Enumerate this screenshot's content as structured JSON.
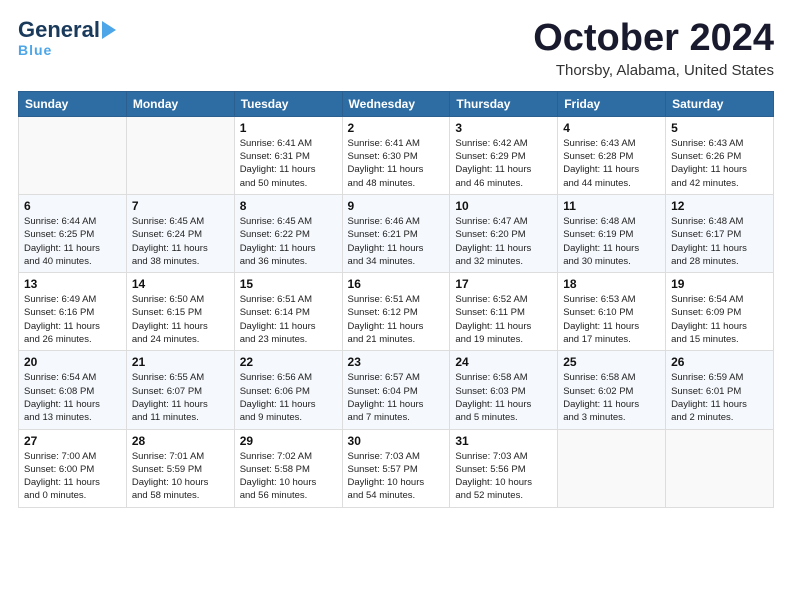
{
  "header": {
    "logo_line1a": "General",
    "logo_line1b": "Blue",
    "month": "October 2024",
    "location": "Thorsby, Alabama, United States"
  },
  "weekdays": [
    "Sunday",
    "Monday",
    "Tuesday",
    "Wednesday",
    "Thursday",
    "Friday",
    "Saturday"
  ],
  "weeks": [
    [
      {
        "day": "",
        "sunrise": "",
        "sunset": "",
        "daylight": ""
      },
      {
        "day": "",
        "sunrise": "",
        "sunset": "",
        "daylight": ""
      },
      {
        "day": "1",
        "sunrise": "Sunrise: 6:41 AM",
        "sunset": "Sunset: 6:31 PM",
        "daylight": "Daylight: 11 hours and 50 minutes."
      },
      {
        "day": "2",
        "sunrise": "Sunrise: 6:41 AM",
        "sunset": "Sunset: 6:30 PM",
        "daylight": "Daylight: 11 hours and 48 minutes."
      },
      {
        "day": "3",
        "sunrise": "Sunrise: 6:42 AM",
        "sunset": "Sunset: 6:29 PM",
        "daylight": "Daylight: 11 hours and 46 minutes."
      },
      {
        "day": "4",
        "sunrise": "Sunrise: 6:43 AM",
        "sunset": "Sunset: 6:28 PM",
        "daylight": "Daylight: 11 hours and 44 minutes."
      },
      {
        "day": "5",
        "sunrise": "Sunrise: 6:43 AM",
        "sunset": "Sunset: 6:26 PM",
        "daylight": "Daylight: 11 hours and 42 minutes."
      }
    ],
    [
      {
        "day": "6",
        "sunrise": "Sunrise: 6:44 AM",
        "sunset": "Sunset: 6:25 PM",
        "daylight": "Daylight: 11 hours and 40 minutes."
      },
      {
        "day": "7",
        "sunrise": "Sunrise: 6:45 AM",
        "sunset": "Sunset: 6:24 PM",
        "daylight": "Daylight: 11 hours and 38 minutes."
      },
      {
        "day": "8",
        "sunrise": "Sunrise: 6:45 AM",
        "sunset": "Sunset: 6:22 PM",
        "daylight": "Daylight: 11 hours and 36 minutes."
      },
      {
        "day": "9",
        "sunrise": "Sunrise: 6:46 AM",
        "sunset": "Sunset: 6:21 PM",
        "daylight": "Daylight: 11 hours and 34 minutes."
      },
      {
        "day": "10",
        "sunrise": "Sunrise: 6:47 AM",
        "sunset": "Sunset: 6:20 PM",
        "daylight": "Daylight: 11 hours and 32 minutes."
      },
      {
        "day": "11",
        "sunrise": "Sunrise: 6:48 AM",
        "sunset": "Sunset: 6:19 PM",
        "daylight": "Daylight: 11 hours and 30 minutes."
      },
      {
        "day": "12",
        "sunrise": "Sunrise: 6:48 AM",
        "sunset": "Sunset: 6:17 PM",
        "daylight": "Daylight: 11 hours and 28 minutes."
      }
    ],
    [
      {
        "day": "13",
        "sunrise": "Sunrise: 6:49 AM",
        "sunset": "Sunset: 6:16 PM",
        "daylight": "Daylight: 11 hours and 26 minutes."
      },
      {
        "day": "14",
        "sunrise": "Sunrise: 6:50 AM",
        "sunset": "Sunset: 6:15 PM",
        "daylight": "Daylight: 11 hours and 24 minutes."
      },
      {
        "day": "15",
        "sunrise": "Sunrise: 6:51 AM",
        "sunset": "Sunset: 6:14 PM",
        "daylight": "Daylight: 11 hours and 23 minutes."
      },
      {
        "day": "16",
        "sunrise": "Sunrise: 6:51 AM",
        "sunset": "Sunset: 6:12 PM",
        "daylight": "Daylight: 11 hours and 21 minutes."
      },
      {
        "day": "17",
        "sunrise": "Sunrise: 6:52 AM",
        "sunset": "Sunset: 6:11 PM",
        "daylight": "Daylight: 11 hours and 19 minutes."
      },
      {
        "day": "18",
        "sunrise": "Sunrise: 6:53 AM",
        "sunset": "Sunset: 6:10 PM",
        "daylight": "Daylight: 11 hours and 17 minutes."
      },
      {
        "day": "19",
        "sunrise": "Sunrise: 6:54 AM",
        "sunset": "Sunset: 6:09 PM",
        "daylight": "Daylight: 11 hours and 15 minutes."
      }
    ],
    [
      {
        "day": "20",
        "sunrise": "Sunrise: 6:54 AM",
        "sunset": "Sunset: 6:08 PM",
        "daylight": "Daylight: 11 hours and 13 minutes."
      },
      {
        "day": "21",
        "sunrise": "Sunrise: 6:55 AM",
        "sunset": "Sunset: 6:07 PM",
        "daylight": "Daylight: 11 hours and 11 minutes."
      },
      {
        "day": "22",
        "sunrise": "Sunrise: 6:56 AM",
        "sunset": "Sunset: 6:06 PM",
        "daylight": "Daylight: 11 hours and 9 minutes."
      },
      {
        "day": "23",
        "sunrise": "Sunrise: 6:57 AM",
        "sunset": "Sunset: 6:04 PM",
        "daylight": "Daylight: 11 hours and 7 minutes."
      },
      {
        "day": "24",
        "sunrise": "Sunrise: 6:58 AM",
        "sunset": "Sunset: 6:03 PM",
        "daylight": "Daylight: 11 hours and 5 minutes."
      },
      {
        "day": "25",
        "sunrise": "Sunrise: 6:58 AM",
        "sunset": "Sunset: 6:02 PM",
        "daylight": "Daylight: 11 hours and 3 minutes."
      },
      {
        "day": "26",
        "sunrise": "Sunrise: 6:59 AM",
        "sunset": "Sunset: 6:01 PM",
        "daylight": "Daylight: 11 hours and 2 minutes."
      }
    ],
    [
      {
        "day": "27",
        "sunrise": "Sunrise: 7:00 AM",
        "sunset": "Sunset: 6:00 PM",
        "daylight": "Daylight: 11 hours and 0 minutes."
      },
      {
        "day": "28",
        "sunrise": "Sunrise: 7:01 AM",
        "sunset": "Sunset: 5:59 PM",
        "daylight": "Daylight: 10 hours and 58 minutes."
      },
      {
        "day": "29",
        "sunrise": "Sunrise: 7:02 AM",
        "sunset": "Sunset: 5:58 PM",
        "daylight": "Daylight: 10 hours and 56 minutes."
      },
      {
        "day": "30",
        "sunrise": "Sunrise: 7:03 AM",
        "sunset": "Sunset: 5:57 PM",
        "daylight": "Daylight: 10 hours and 54 minutes."
      },
      {
        "day": "31",
        "sunrise": "Sunrise: 7:03 AM",
        "sunset": "Sunset: 5:56 PM",
        "daylight": "Daylight: 10 hours and 52 minutes."
      },
      {
        "day": "",
        "sunrise": "",
        "sunset": "",
        "daylight": ""
      },
      {
        "day": "",
        "sunrise": "",
        "sunset": "",
        "daylight": ""
      }
    ]
  ]
}
